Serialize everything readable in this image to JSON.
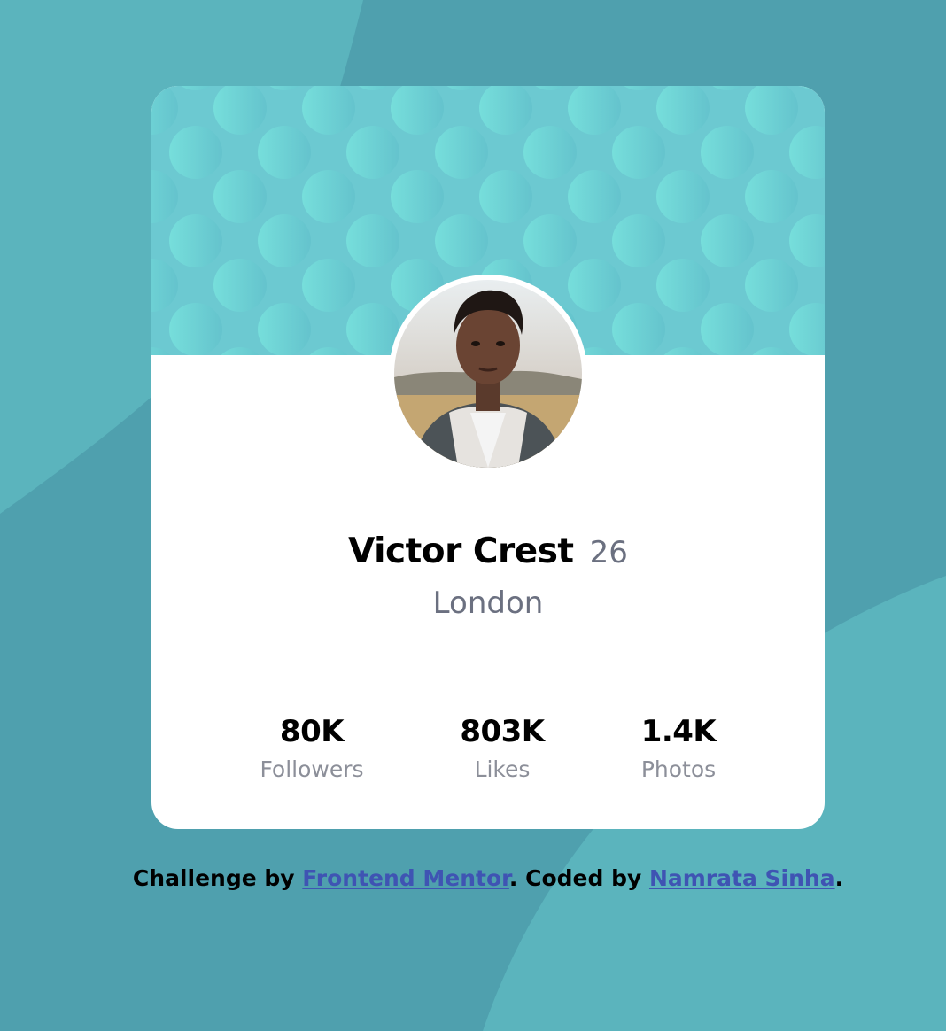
{
  "profile": {
    "name": "Victor Crest",
    "age": "26",
    "location": "London"
  },
  "stats": [
    {
      "value": "80K",
      "label": "Followers"
    },
    {
      "value": "803K",
      "label": "Likes"
    },
    {
      "value": "1.4K",
      "label": "Photos"
    }
  ],
  "footer": {
    "prefix": "Challenge by ",
    "link1": "Frontend Mentor",
    "middle": ". Coded by ",
    "link2": "Namrata Sinha",
    "suffix": "."
  },
  "colors": {
    "background": "#4fa0ae",
    "background_shape": "#5bb4bd",
    "header_pattern": "#6bcbd1",
    "card": "#ffffff",
    "muted_text": "#6b7080",
    "link": "#3f54b3"
  },
  "icons": {
    "avatar": "profile-photo"
  }
}
